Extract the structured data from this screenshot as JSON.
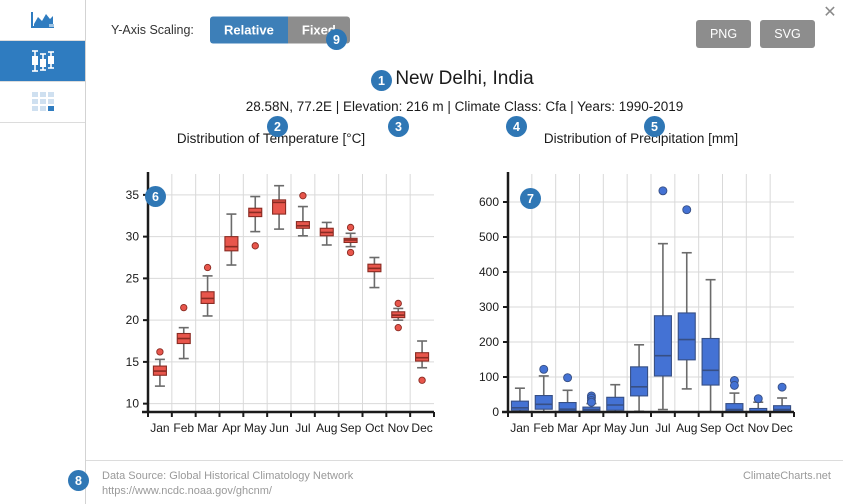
{
  "sidebar": {
    "items": [
      {
        "name": "area-chart",
        "icon": "area-chart-icon",
        "active": false
      },
      {
        "name": "boxplot-chart",
        "icon": "boxplot-icon",
        "active": true
      },
      {
        "name": "data-table",
        "icon": "table-grid-icon",
        "active": false
      }
    ]
  },
  "toolbar": {
    "yaxis_label": "Y-Axis Scaling:",
    "toggle_relative": "Relative",
    "toggle_fixed": "Fixed",
    "png_label": "PNG",
    "svg_label": "SVG",
    "close_label": "✕"
  },
  "header": {
    "title": "New Delhi, India",
    "subtitle": "28.58N, 77.2E | Elevation: 216 m | Climate Class: Cfa | Years: 1990-2019",
    "temp_chart_title": "Distribution of Temperature [°C]",
    "prec_chart_title": "Distribution of Precipitation [mm]"
  },
  "badges": {
    "b1": "1",
    "b2": "2",
    "b3": "3",
    "b4": "4",
    "b5": "5",
    "b6": "6",
    "b7": "7",
    "b8": "8",
    "b9": "9"
  },
  "footer": {
    "source_line1": "Data Source: Global Historical Climatology Network",
    "source_line2": "https://www.ncdc.noaa.gov/ghcnm/",
    "brand": "ClimateCharts.net"
  },
  "chart_data": [
    {
      "type": "boxplot",
      "id": "temperature",
      "title": "Distribution of Temperature [°C]",
      "xlabel": "",
      "ylabel": "",
      "ylim": [
        9,
        37.5
      ],
      "yticks": [
        10,
        15,
        20,
        25,
        30,
        35
      ],
      "grid": true,
      "categories": [
        "Jan",
        "Feb",
        "Mar",
        "Apr",
        "May",
        "Jun",
        "Jul",
        "Aug",
        "Sep",
        "Oct",
        "Nov",
        "Dec"
      ],
      "boxes": [
        {
          "category": "Jan",
          "min": 12.1,
          "q1": 13.4,
          "median": 13.9,
          "q3": 14.5,
          "max": 15.3,
          "outliers": [
            16.2
          ]
        },
        {
          "category": "Feb",
          "min": 15.4,
          "q1": 17.2,
          "median": 17.8,
          "q3": 18.4,
          "max": 19.1,
          "outliers": [
            21.5
          ]
        },
        {
          "category": "Mar",
          "min": 20.5,
          "q1": 22.0,
          "median": 22.6,
          "q3": 23.4,
          "max": 25.3,
          "outliers": [
            26.3
          ]
        },
        {
          "category": "Apr",
          "min": 26.6,
          "q1": 28.3,
          "median": 28.8,
          "q3": 30.0,
          "max": 32.7,
          "outliers": []
        },
        {
          "category": "May",
          "min": 30.6,
          "q1": 32.4,
          "median": 32.9,
          "q3": 33.4,
          "max": 34.8,
          "outliers": [
            28.9
          ]
        },
        {
          "category": "Jun",
          "min": 30.9,
          "q1": 32.7,
          "median": 34.1,
          "q3": 34.4,
          "max": 36.1,
          "outliers": []
        },
        {
          "category": "Jul",
          "min": 30.1,
          "q1": 31.0,
          "median": 31.3,
          "q3": 31.8,
          "max": 33.6,
          "outliers": [
            34.9
          ]
        },
        {
          "category": "Aug",
          "min": 29.0,
          "q1": 30.1,
          "median": 30.5,
          "q3": 31.0,
          "max": 31.7,
          "outliers": []
        },
        {
          "category": "Sep",
          "min": 28.8,
          "q1": 29.3,
          "median": 29.6,
          "q3": 29.8,
          "max": 30.4,
          "outliers": [
            31.1,
            28.1
          ]
        },
        {
          "category": "Oct",
          "min": 23.9,
          "q1": 25.8,
          "median": 26.2,
          "q3": 26.7,
          "max": 27.5,
          "outliers": []
        },
        {
          "category": "Nov",
          "min": 20.0,
          "q1": 20.3,
          "median": 20.6,
          "q3": 21.0,
          "max": 21.4,
          "outliers": [
            22.0,
            19.1
          ]
        },
        {
          "category": "Dec",
          "min": 14.3,
          "q1": 15.1,
          "median": 15.5,
          "q3": 16.1,
          "max": 17.5,
          "outliers": [
            12.8
          ]
        }
      ]
    },
    {
      "type": "boxplot",
      "id": "precipitation",
      "title": "Distribution of Precipitation [mm]",
      "xlabel": "",
      "ylabel": "",
      "ylim": [
        0,
        680
      ],
      "yticks": [
        0,
        100,
        200,
        300,
        400,
        500,
        600
      ],
      "grid": true,
      "categories": [
        "Jan",
        "Feb",
        "Mar",
        "Apr",
        "May",
        "Jun",
        "Jul",
        "Aug",
        "Sep",
        "Oct",
        "Nov",
        "Dec"
      ],
      "boxes": [
        {
          "category": "Jan",
          "min": 0,
          "q1": 5,
          "median": 12,
          "q3": 31,
          "max": 68,
          "outliers": []
        },
        {
          "category": "Feb",
          "min": 0,
          "q1": 8,
          "median": 22,
          "q3": 47,
          "max": 103,
          "outliers": [
            122
          ]
        },
        {
          "category": "Mar",
          "min": 0,
          "q1": 3,
          "median": 8,
          "q3": 27,
          "max": 62,
          "outliers": [
            98
          ]
        },
        {
          "category": "Apr",
          "min": 0,
          "q1": 2,
          "median": 7,
          "q3": 14,
          "max": 24,
          "outliers": [
            46,
            40,
            33,
            28
          ]
        },
        {
          "category": "May",
          "min": 0,
          "q1": 5,
          "median": 20,
          "q3": 42,
          "max": 78,
          "outliers": []
        },
        {
          "category": "Jun",
          "min": 2,
          "q1": 46,
          "median": 72,
          "q3": 129,
          "max": 192,
          "outliers": []
        },
        {
          "category": "Jul",
          "min": 7,
          "q1": 103,
          "median": 161,
          "q3": 275,
          "max": 481,
          "outliers": [
            632
          ]
        },
        {
          "category": "Aug",
          "min": 66,
          "q1": 149,
          "median": 207,
          "q3": 283,
          "max": 455,
          "outliers": [
            578
          ]
        },
        {
          "category": "Sep",
          "min": 0,
          "q1": 77,
          "median": 119,
          "q3": 210,
          "max": 378,
          "outliers": []
        },
        {
          "category": "Oct",
          "min": 0,
          "q1": 2,
          "median": 7,
          "q3": 24,
          "max": 54,
          "outliers": [
            90,
            76
          ]
        },
        {
          "category": "Nov",
          "min": 0,
          "q1": 0,
          "median": 2,
          "q3": 10,
          "max": 28,
          "outliers": [
            38
          ]
        },
        {
          "category": "Dec",
          "min": 0,
          "q1": 2,
          "median": 7,
          "q3": 18,
          "max": 40,
          "outliers": [
            71
          ]
        }
      ]
    }
  ]
}
